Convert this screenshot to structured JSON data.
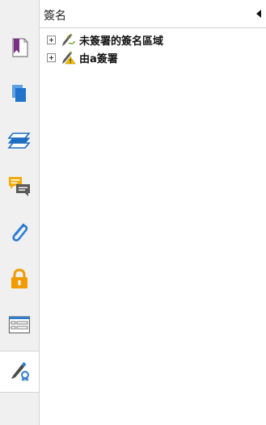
{
  "panel": {
    "title": "簽名"
  },
  "sidebar": {
    "items": [
      {
        "icon": "bookmark-icon"
      },
      {
        "icon": "pages-icon"
      },
      {
        "icon": "layers-icon"
      },
      {
        "icon": "comments-icon"
      },
      {
        "icon": "attachments-icon"
      },
      {
        "icon": "lock-icon"
      },
      {
        "icon": "form-fields-icon"
      },
      {
        "icon": "signatures-icon"
      }
    ]
  },
  "tree": {
    "rows": [
      {
        "label": "未簽署的簽名區域",
        "icon": "unsigned-signature-icon"
      },
      {
        "label": "由a簽署",
        "icon": "signed-warning-icon"
      }
    ]
  },
  "colors": {
    "bookmark": "#7b2f86",
    "pages": "#1f73c8",
    "layers": "#1e6dc1",
    "comments": "#f2a900",
    "paperclip": "#2b7bd3",
    "lock": "#f29a00",
    "form": "#2e7cd0"
  }
}
